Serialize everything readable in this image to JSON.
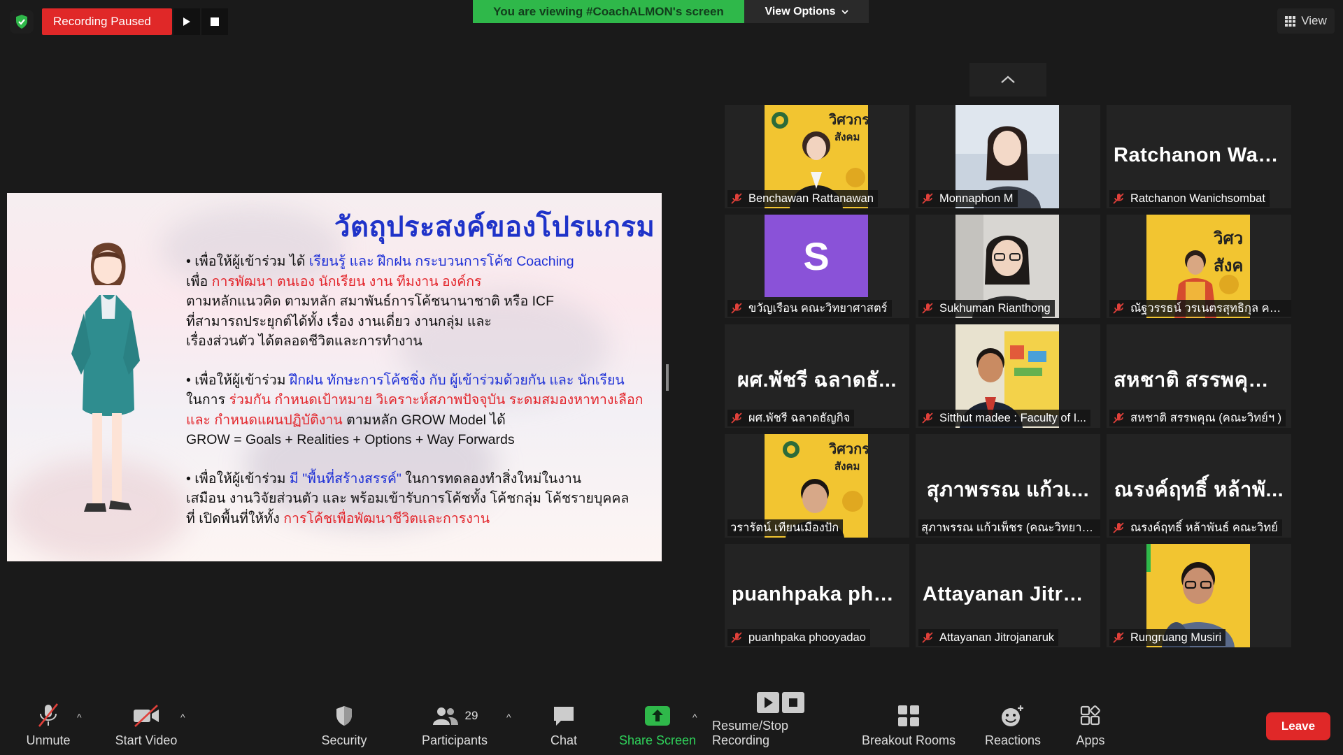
{
  "top": {
    "recording_status": "Recording Paused",
    "viewing_banner": "You are viewing #CoachALMON's screen",
    "view_options": "View Options",
    "view_label": "View"
  },
  "slide": {
    "title": "วัตถุประสงค์ของโปรแกรม",
    "p1": {
      "a": "• เพื่อให้ผู้เข้าร่วม ได้ ",
      "b": "เรียนรู้ และ ฝึกฝน กระบวนการโค้ช Coaching",
      "c": "เพื่อ ",
      "d": "การพัฒนา ตนเอง นักเรียน งาน ทีมงาน องค์กร",
      "e": "ตามหลักแนวคิด ตามหลัก สมาพันธ์การโค้ชนานาชาติ หรือ ICF",
      "f": "ที่สามารถประยุกต์ได้ทั้ง เรื่อง งานเดี่ยว งานกลุ่ม และ",
      "g": "เรื่องส่วนตัว ได้ตลอดชีวิตและการทำงาน"
    },
    "p2": {
      "a": "• เพื่อให้ผู้เข้าร่วม ",
      "b": "ฝึกฝน ทักษะการโค้ชชิ่ง กับ ผู้เข้าร่วมด้วยกัน และ นักเรียน",
      "c": "ในการ ",
      "d": "ร่วมกัน กำหนดเป้าหมาย วิเคราะห์สภาพปัจจุบัน ระดมสมองหาทางเลือก",
      "e": "และ กำหนดแผนปฏิบัติงาน",
      "f": " ตามหลัก GROW Model ได้",
      "g": "GROW = Goals + Realities + Options + Way Forwards"
    },
    "p3": {
      "a": "• เพื่อให้ผู้เข้าร่วม ",
      "b": "มี \"พื้นที่สร้างสรรค์\"",
      "c": " ในการทดลองทำสิ่งใหม่ในงาน",
      "d": "เสมือน งานวิจัยส่วนตัว และ พร้อมเข้ารับการโค้ชทั้ง โค้ชกลุ่ม โค้ชรายบุคคล",
      "e": "ที่ เปิดพื้นที่ให้ทั้ง ",
      "f": "การโค้ชเพื่อพัฒนาชีวิตและการงาน"
    }
  },
  "participants": [
    {
      "name": "Benchawan Rattanawan",
      "big": ""
    },
    {
      "name": "Monnaphon M",
      "big": ""
    },
    {
      "name": "Ratchanon Wanichsombat",
      "big": "Ratchanon  Wan..."
    },
    {
      "name": "ขวัญเรือน คณะวิทยาศาสตร์",
      "big": "",
      "avatar": "S"
    },
    {
      "name": "Sukhuman Rianthong",
      "big": ""
    },
    {
      "name": "ณัฐวรรธน์ วรเนตรสุทธิกุล คณะ...",
      "big": ""
    },
    {
      "name": "ผศ.พัชรี  ฉลาดธัญกิจ",
      "big": "ผศ.พัชรี  ฉลาดธั..."
    },
    {
      "name": "Sitthut madee : Faculty of I...",
      "big": ""
    },
    {
      "name": "สหชาติ สรรพคุณ (คณะวิทย์ฯ )",
      "big": "สหชาติ สรรพคุณ..."
    },
    {
      "name": "วรารัตน์ เทียนเมืองปัก",
      "big": ""
    },
    {
      "name": "สุภาพรรณ  แก้วเพ็ชร  (คณะวิทยาก...",
      "big": "สุภาพรรณ  แก้วเ..."
    },
    {
      "name": "ณรงค์ฤทธิ์ หล้าพันธ์ คณะวิทย์",
      "big": "ณรงค์ฤทธิ์ หล้าพั..."
    },
    {
      "name": "puanhpaka phooyadao",
      "big": "puanhpaka  pho..."
    },
    {
      "name": "Attayanan Jitrojanaruk",
      "big": "Attayanan  Jitroj..."
    },
    {
      "name": "Rungruang Musiri",
      "big": ""
    }
  ],
  "poster_text": {
    "line1": "วิศวกร",
    "line2": "สังคม",
    "short": "วิศว สังค"
  },
  "toolbar": {
    "unmute": "Unmute",
    "start_video": "Start Video",
    "security": "Security",
    "participants": "Participants",
    "participants_count": "29",
    "chat": "Chat",
    "share_screen": "Share Screen",
    "resume_stop": "Resume/Stop Recording",
    "breakout": "Breakout Rooms",
    "reactions": "Reactions",
    "apps": "Apps",
    "leave": "Leave"
  },
  "colors": {
    "green": "#2fb84a",
    "red": "#e02828",
    "mic_off_red": "#e0403a",
    "avatar_purple": "#8a52d8",
    "poster_yellow": "#f2c531"
  }
}
